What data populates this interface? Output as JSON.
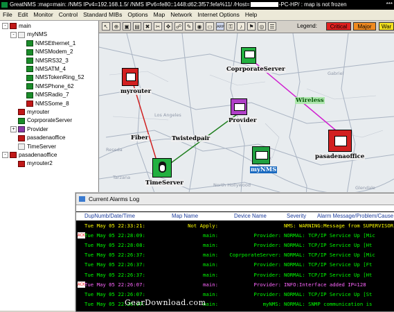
{
  "window": {
    "title": "GreatNMS :map=main: /NMS IPv4=192.168.1.5/ /NMS IPv6=fe80::1448:d62:3f57:fefa%11/ /Host=",
    "title_suffix": "-PC-HP/ : map is not frozen",
    "title_right": "***"
  },
  "menu": [
    "File",
    "Edit",
    "Monitor",
    "Control",
    "Standard MIBs",
    "Options",
    "Map",
    "Network",
    "Internet Options",
    "Help"
  ],
  "tree": [
    {
      "label": "main",
      "indent": 0,
      "icon": "red",
      "expander": "-"
    },
    {
      "label": "myNMS",
      "indent": 1,
      "icon": "white",
      "expander": "-"
    },
    {
      "label": "NMSEthernet_1",
      "indent": 2,
      "icon": "green"
    },
    {
      "label": "NMSModem_2",
      "indent": 2,
      "icon": "green"
    },
    {
      "label": "NMSRS32_3",
      "indent": 2,
      "icon": "green"
    },
    {
      "label": "NMSATM_4",
      "indent": 2,
      "icon": "green"
    },
    {
      "label": "NMSTokenRing_52",
      "indent": 2,
      "icon": "green"
    },
    {
      "label": "NMSPhone_62",
      "indent": 2,
      "icon": "green"
    },
    {
      "label": "NMSRadio_7",
      "indent": 2,
      "icon": "green"
    },
    {
      "label": "NMSSome_8",
      "indent": 2,
      "icon": "red"
    },
    {
      "label": "myrouter",
      "indent": 1,
      "icon": "red"
    },
    {
      "label": "CoprporateServer",
      "indent": 1,
      "icon": "green"
    },
    {
      "label": "Provider",
      "indent": 1,
      "icon": "purple",
      "expander": "+"
    },
    {
      "label": "pasadenaoffice",
      "indent": 1,
      "icon": "red"
    },
    {
      "label": "TimeServer",
      "indent": 1,
      "icon": "white"
    },
    {
      "label": "pasadenaoffice",
      "indent": 0,
      "icon": "red",
      "expander": "-"
    },
    {
      "label": "myrouter2",
      "indent": 1,
      "icon": "red"
    }
  ],
  "toolbar": {
    "buttons": [
      "select-tool",
      "zoom-tool",
      "copy-tool",
      "paste-tool",
      "delete-tool",
      "cut-tool",
      "move-tool",
      "link-tool",
      "edit-tool",
      "camera-tool",
      "monitor-tool",
      "arp-tool",
      "lock-tool",
      "bell-tool",
      "trap-tool",
      "ring-tool",
      "tree-tool"
    ],
    "arp_label": "ARP",
    "legend_label": "Legend:",
    "legend": [
      {
        "label": "Critical",
        "color": "#e02020"
      },
      {
        "label": "Major",
        "color": "#f08a20"
      },
      {
        "label": "War",
        "color": "#f2e020"
      }
    ]
  },
  "map": {
    "nodes": [
      {
        "name": "myrouter",
        "color": "#d22020"
      },
      {
        "name": "CoprporateServer",
        "color": "#22b040"
      },
      {
        "name": "Provider",
        "color": "#b040c8"
      },
      {
        "name": "pasadenaoffice",
        "color": "#d22020"
      },
      {
        "name": "myNMS",
        "color": "#20a040"
      },
      {
        "name": "TimeServer",
        "color": "#22b040"
      }
    ],
    "links": [
      {
        "label": "Fiber",
        "color": "#d02020"
      },
      {
        "label": "Twistedpair",
        "color": "#208020"
      },
      {
        "label": "Wireless",
        "color": "#d020d0"
      }
    ]
  },
  "alarms": {
    "title": "Current Alarms Log",
    "columns": [
      "DupNumb/Date/Time",
      "Map Name",
      "Device Name",
      "Severity",
      "Alarm Message/Problem/Cause"
    ],
    "rows": [
      {
        "ack": "",
        "date": "Tue May 05 22:33:21:",
        "map": "Not Apply:",
        "device": "",
        "msg": "NMS: WARNING:Message from SUPERVISOR",
        "color": "#ffff00"
      },
      {
        "ack": "ACK",
        "date": "Tue May 05 22:28:09:",
        "map": "main:",
        "device": "Provider:",
        "msg": "NORMAL: TCP/IP Service Up [Mic",
        "color": "#00ff00"
      },
      {
        "ack": "",
        "date": "Tue May 05 22:28:08:",
        "map": "main:",
        "device": "Provider:",
        "msg": "NORMAL: TCP/IP Service Up [Ht",
        "color": "#00ff00"
      },
      {
        "ack": "",
        "date": "Tue May 05 22:26:37:",
        "map": "main:",
        "device": "CoprporateServer:",
        "msg": "NORMAL: TCP/IP Service Up [Mic",
        "color": "#00ff00"
      },
      {
        "ack": "",
        "date": "Tue May 05 22:26:37:",
        "map": "main:",
        "device": "Provider:",
        "msg": "NORMAL: TCP/IP Service Up [Ft",
        "color": "#00ff00"
      },
      {
        "ack": "",
        "date": "Tue May 05 22:26:37:",
        "map": "main:",
        "device": "Provider:",
        "msg": "NORMAL: TCP/IP Service Up [Ht",
        "color": "#00ff00"
      },
      {
        "ack": "ACK",
        "date": "Tue May 05 22:26:07:",
        "map": "main:",
        "device": "Provider:",
        "msg": "INFO:Interface added IP=128",
        "color": "#ff66ff"
      },
      {
        "ack": "",
        "date": "Tue May 05 22:26:07:",
        "map": "main:",
        "device": "Provider:",
        "msg": "NORMAL: TCP/IP Service Up [St",
        "color": "#00ff00"
      },
      {
        "ack": "",
        "date": "Tue May 05 22:26:07:",
        "map": "main:",
        "device": "myNMS:",
        "msg": "NORMAL: SNMP communication is",
        "color": "#00ff00"
      }
    ]
  },
  "watermark": "GearDownload.com"
}
